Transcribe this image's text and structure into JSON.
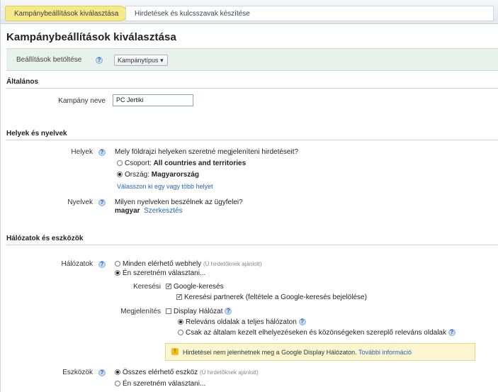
{
  "tabs": [
    {
      "label": "Kampánybeállítások kiválasztása"
    },
    {
      "label": "Hirdetések és kulcsszavak készítése"
    }
  ],
  "page_title": "Kampánybeállítások kiválasztása",
  "load_settings": {
    "label": "Beállítások betöltése",
    "select_value": "Kampánytípus"
  },
  "sections": {
    "general": {
      "heading": "Általános",
      "campaign_name_label": "Kampány neve",
      "campaign_name_value": "PC Jertiki"
    },
    "locations": {
      "heading": "Helyek és nyelvek",
      "locations_label": "Helyek",
      "locations_question": "Mely földrajzi helyeken szeretné megjeleníteni hirdetéseit?",
      "group_prefix": "Csoport:",
      "group_value": "All countries and territories",
      "country_prefix": "Ország:",
      "country_value": "Magyarország",
      "choose_link": "Válasszon ki egy vagy több helyet",
      "languages_label": "Nyelvek",
      "languages_question": "Milyen nyelveken beszélnek az ügyfelei?",
      "language_value": "magyar",
      "edit_link": "Szerkesztés"
    },
    "networks": {
      "heading": "Hálózatok és eszközök",
      "networks_label": "Hálózatok",
      "all_networks": "Minden elérhető webhely",
      "all_networks_note": "(Ú hirdetőknek ajánlott)",
      "custom_networks": "Én szeretném választani...",
      "search_label": "Keresési",
      "google_search": "Google-keresés",
      "search_partners": "Keresési partnerek (feltétele a Google-keresés bejelölése)",
      "display_label": "Megjelenítés",
      "display_network": "Display Hálózat",
      "relevant_pages_all": "Releváns oldalak a teljes hálózaton",
      "relevant_pages_managed": "Csak az általam kezelt elhelyezéseken és közönségeken szereplő releváns oldalak",
      "warning_text": "Hirdetései nem jelenhetnek meg a Google Display Hálózaton.",
      "warning_link": "További információ",
      "devices_label": "Eszközök",
      "all_devices": "Összes elérhető eszköz",
      "all_devices_note": "(Ú hirdetőknek ajánlott)",
      "custom_devices": "Én szeretném választani..."
    }
  }
}
